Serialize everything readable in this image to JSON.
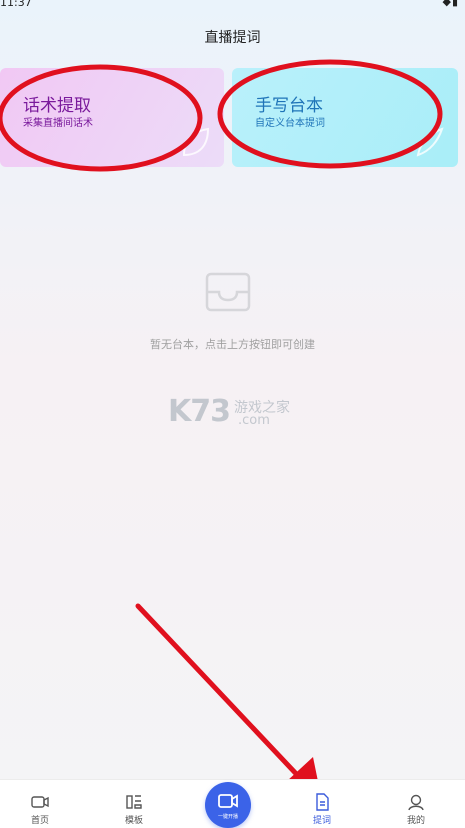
{
  "status_bar": {
    "time": "11:37",
    "icons": "◆▮"
  },
  "header": {
    "title": "直播提词"
  },
  "cards": [
    {
      "title": "话术提取",
      "subtitle": "采集直播间话术"
    },
    {
      "title": "手写台本",
      "subtitle": "自定义台本提词"
    }
  ],
  "empty_state": {
    "message": "暂无台本，点击上方按钮即可创建",
    "icon": "inbox-icon"
  },
  "watermark": {
    "brand": "K73",
    "text": "游戏之家",
    "domain": ".com"
  },
  "tabbar": {
    "tabs": [
      {
        "label": "首页",
        "icon": "video-camera-icon"
      },
      {
        "label": "模板",
        "icon": "template-icon"
      },
      {
        "label": "提词",
        "icon": "document-icon",
        "active": true
      },
      {
        "label": "我的",
        "icon": "user-icon"
      }
    ],
    "center_button": {
      "label": "一键开播",
      "icon": "video-camera-icon"
    }
  },
  "colors": {
    "accent": "#3b63e8",
    "annotation": "#e0101e"
  }
}
